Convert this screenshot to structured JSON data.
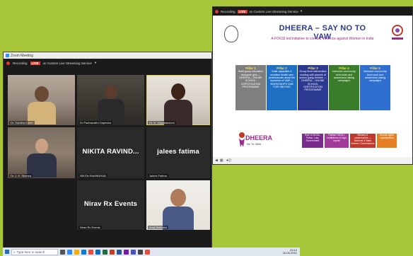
{
  "zoom": {
    "window_title": "Zoom Meeting",
    "recording_label": "Recording",
    "live_badge": "LIVE",
    "stream_label": "on Custom Live Streaming Service",
    "participants": [
      {
        "name": "Dr. Sumitra Kuber",
        "type": "video"
      },
      {
        "name": "Dr Padmavathi Gajendra",
        "type": "video"
      },
      {
        "name": "Dr. N. Vijayalakshmi",
        "type": "video",
        "active": true
      },
      {
        "name": "Dr. J. K. Sharma",
        "type": "video"
      },
      {
        "name": "NIKITA RAVINDRAN",
        "display_name": "NIKITA RAVIND...",
        "type": "name"
      },
      {
        "name": "Jalees Fatima",
        "display_name": "jalees fatima",
        "type": "name"
      },
      {
        "name": "Nirav Rx Events",
        "display_name": "Nirav Rx Events",
        "type": "name"
      },
      {
        "name": "Anuj Malhotra",
        "type": "video"
      }
    ]
  },
  "slide": {
    "recording_label": "Recording",
    "live_badge": "LIVE",
    "stream_label": "on Custom Live Streaming Service",
    "title": "DHEERA – SAY NO TO VAW",
    "subtitle": "A FOGSI led initiative to combat Violence against Women in India",
    "pillars": [
      {
        "head": "Pillar 1",
        "body": "Build group education alongside girls — DHEERA – ONLINE SCHOOL CERTIFICATION PROGRAMME",
        "color": "#7f7f7f"
      },
      {
        "head": "Pillar 2",
        "body": "Build capacities & sensitise health care professionals about the dynamics of VAW — WORKSHOPS CME FOR OBGYNS",
        "color": "#1f6fc5"
      },
      {
        "head": "Pillar 3",
        "body": "Group level intervention working with parents of school going children — DHEERA – ONLINE SCHOOL CERTIFICATION PROGRAMME",
        "color": "#2b3990"
      },
      {
        "head": "Pillar 4",
        "body": "Intensive community level work and awareness raising campaigns",
        "color": "#3a7d2a"
      },
      {
        "head": "Pillar 5",
        "body": "Intensive community level work and awareness raising campaigns",
        "color": "#2e6fcf"
      }
    ],
    "lower_boxes": [
      {
        "text": "Role of NGOs, Police, Law, Government",
        "color": "#7a2a8c"
      },
      {
        "text": "Partner NGOs / Institutions of high repute",
        "color": "#a23a9c"
      },
      {
        "text": "Ministry & commissions — National & State Women Commissions",
        "color": "#c0392b"
      },
      {
        "text": "Human rights organisations",
        "color": "#e67e22"
      }
    ],
    "logo_text": "DHEERA",
    "logo_subtext": "No To VAW"
  },
  "taskbar": {
    "search_placeholder": "Type here to search",
    "time": "20:12",
    "date": "16-03-2021"
  }
}
